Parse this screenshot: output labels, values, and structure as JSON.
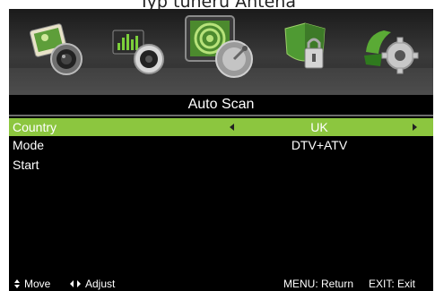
{
  "caption": "Typ tuneru Antena",
  "menu_icons": [
    {
      "name": "picture-icon",
      "selected": false
    },
    {
      "name": "sound-icon",
      "selected": false
    },
    {
      "name": "channel-icon",
      "selected": true
    },
    {
      "name": "lock-icon",
      "selected": false
    },
    {
      "name": "setup-icon",
      "selected": false
    }
  ],
  "page_title": "Auto Scan",
  "rows": [
    {
      "label": "Country",
      "value": "UK",
      "highlight": true
    },
    {
      "label": "Mode",
      "value": "DTV+ATV",
      "highlight": false
    },
    {
      "label": "Start",
      "value": "",
      "highlight": false
    }
  ],
  "footer": {
    "move": "Move",
    "adjust": "Adjust",
    "menu_return": "MENU: Return",
    "exit": "EXIT: Exit"
  },
  "colors": {
    "highlight": "#8cc63f",
    "background": "#000000",
    "text": "#ffffff"
  }
}
